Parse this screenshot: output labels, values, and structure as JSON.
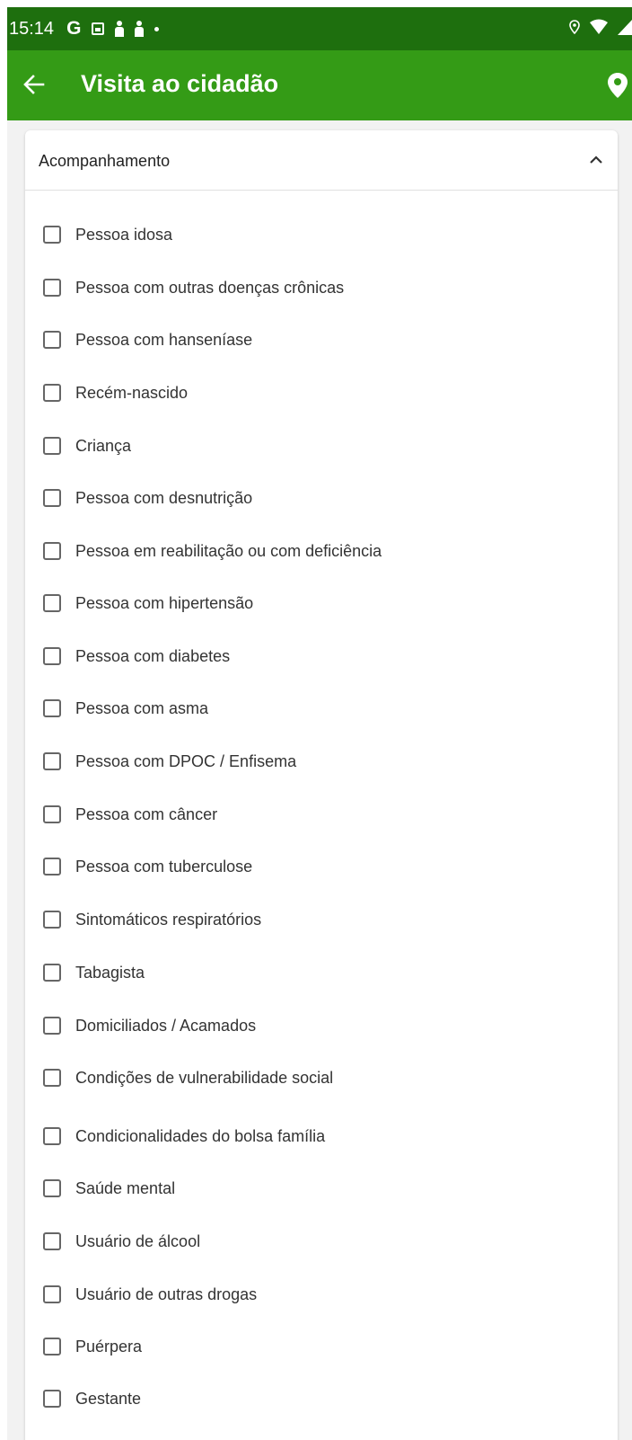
{
  "status_bar": {
    "time": "15:14",
    "left_icons": [
      "google-icon",
      "image-notification-icon",
      "person-notification-icon",
      "person-notification-icon",
      "dot-icon"
    ],
    "right_icons": [
      "location-icon",
      "wifi-icon",
      "signal-icon"
    ]
  },
  "app_bar": {
    "title": "Visita ao cidadão",
    "color": "#349b16",
    "status_color": "#1e6f0e"
  },
  "section": {
    "title": "Acompanhamento",
    "expanded": true,
    "options": [
      {
        "label": "Pessoa idosa",
        "checked": false
      },
      {
        "label": "Pessoa com outras doenças crônicas",
        "checked": false
      },
      {
        "label": "Pessoa com hanseníase",
        "checked": false
      },
      {
        "label": "Recém-nascido",
        "checked": false
      },
      {
        "label": "Criança",
        "checked": false
      },
      {
        "label": "Pessoa com desnutrição",
        "checked": false
      },
      {
        "label": "Pessoa em reabilitação ou com deficiência",
        "checked": false
      },
      {
        "label": "Pessoa com hipertensão",
        "checked": false
      },
      {
        "label": "Pessoa com diabetes",
        "checked": false
      },
      {
        "label": "Pessoa com asma",
        "checked": false
      },
      {
        "label": "Pessoa com DPOC / Enfisema",
        "checked": false
      },
      {
        "label": "Pessoa com câncer",
        "checked": false
      },
      {
        "label": "Pessoa com tuberculose",
        "checked": false
      },
      {
        "label": "Sintomáticos respiratórios",
        "checked": false
      },
      {
        "label": "Tabagista",
        "checked": false
      },
      {
        "label": "Domiciliados / Acamados",
        "checked": false
      },
      {
        "label": "Condições de vulnerabilidade social",
        "checked": false
      },
      {
        "label": "Condicionalidades do bolsa família",
        "checked": false
      },
      {
        "label": "Saúde mental",
        "checked": false
      },
      {
        "label": "Usuário de álcool",
        "checked": false
      },
      {
        "label": "Usuário de outras drogas",
        "checked": false
      },
      {
        "label": "Puérpera",
        "checked": false
      },
      {
        "label": "Gestante",
        "checked": false
      }
    ]
  }
}
